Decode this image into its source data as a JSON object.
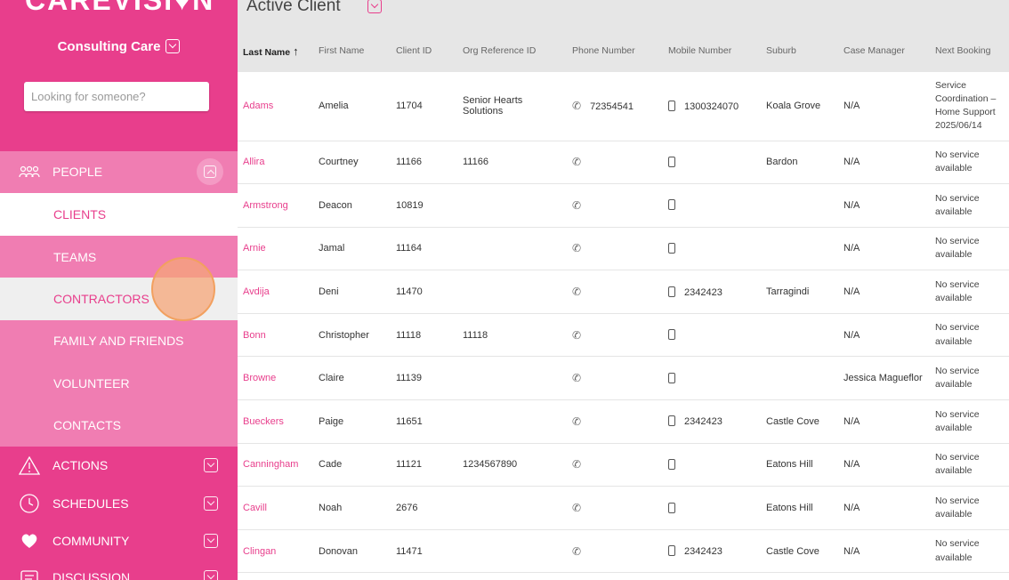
{
  "brand": {
    "logo": "CAREVISION",
    "pink": "#e83e8c"
  },
  "org": {
    "name": "Consulting Care"
  },
  "search": {
    "placeholder": "Looking for someone?"
  },
  "sidebar": {
    "people": {
      "label": "PEOPLE"
    },
    "sub_items": [
      "CLIENTS",
      "TEAMS",
      "CONTRACTORS",
      "FAMILY AND FRIENDS",
      "VOLUNTEER",
      "CONTACTS"
    ],
    "sections": [
      {
        "label": "ACTIONS",
        "icon": "warning-icon"
      },
      {
        "label": "SCHEDULES",
        "icon": "clock-icon"
      },
      {
        "label": "COMMUNITY",
        "icon": "heart-hands-icon"
      },
      {
        "label": "DISCUSSION",
        "icon": "chat-icon"
      }
    ]
  },
  "header": {
    "title": "Active Client"
  },
  "table": {
    "columns": [
      "Last Name",
      "First Name",
      "Client ID",
      "Org Reference ID",
      "Phone Number",
      "Mobile Number",
      "Suburb",
      "Case Manager",
      "Next Booking"
    ],
    "rows": [
      {
        "last": "Adams",
        "first": "Amelia",
        "id": "11704",
        "org_ref": "Senior Hearts Solutions",
        "phone": "72354541",
        "mobile": "1300324070",
        "suburb": "Koala Grove",
        "manager": "N/A",
        "booking": "Service Coordination – Home Support 2025/06/14"
      },
      {
        "last": "Allira",
        "first": "Courtney",
        "id": "11166",
        "org_ref": "11166",
        "phone": "",
        "mobile": "",
        "suburb": "Bardon",
        "manager": "N/A",
        "booking": "No service available"
      },
      {
        "last": "Armstrong",
        "first": "Deacon",
        "id": "10819",
        "org_ref": "",
        "phone": "",
        "mobile": "",
        "suburb": "",
        "manager": "N/A",
        "booking": "No service available"
      },
      {
        "last": "Arnie",
        "first": "Jamal",
        "id": "11164",
        "org_ref": "",
        "phone": "",
        "mobile": "",
        "suburb": "",
        "manager": "N/A",
        "booking": "No service available"
      },
      {
        "last": "Avdija",
        "first": "Deni",
        "id": "11470",
        "org_ref": "",
        "phone": "",
        "mobile": "2342423",
        "suburb": "Tarragindi",
        "manager": "N/A",
        "booking": "No service available"
      },
      {
        "last": "Bonn",
        "first": "Christopher",
        "id": "11118",
        "org_ref": "11118",
        "phone": "",
        "mobile": "",
        "suburb": "",
        "manager": "N/A",
        "booking": "No service available"
      },
      {
        "last": "Browne",
        "first": "Claire",
        "id": "11139",
        "org_ref": "",
        "phone": "",
        "mobile": "",
        "suburb": "",
        "manager": "Jessica Magueflor",
        "booking": "No service available"
      },
      {
        "last": "Bueckers",
        "first": "Paige",
        "id": "11651",
        "org_ref": "",
        "phone": "",
        "mobile": "2342423",
        "suburb": "Castle Cove",
        "manager": "N/A",
        "booking": "No service available"
      },
      {
        "last": "Canningham",
        "first": "Cade",
        "id": "11121",
        "org_ref": "1234567890",
        "phone": "",
        "mobile": "",
        "suburb": "Eatons Hill",
        "manager": "N/A",
        "booking": "No service available"
      },
      {
        "last": "Cavill",
        "first": "Noah",
        "id": "2676",
        "org_ref": "",
        "phone": "",
        "mobile": "",
        "suburb": "Eatons Hill",
        "manager": "N/A",
        "booking": "No service available"
      },
      {
        "last": "Clingan",
        "first": "Donovan",
        "id": "11471",
        "org_ref": "",
        "phone": "",
        "mobile": "2342423",
        "suburb": "Castle Cove",
        "manager": "N/A",
        "booking": "No service available"
      }
    ]
  }
}
